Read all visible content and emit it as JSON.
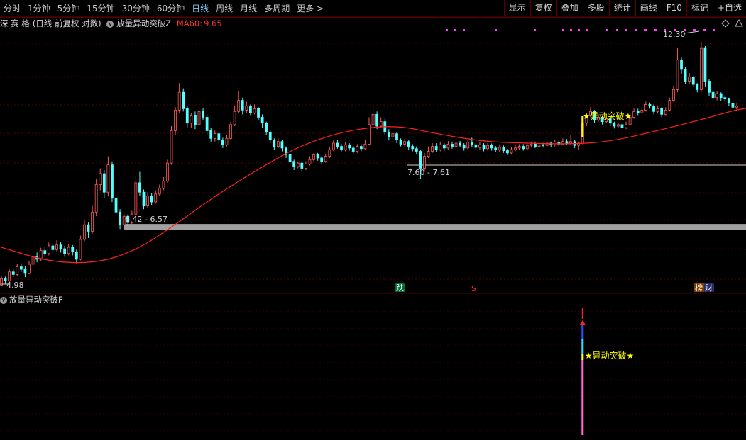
{
  "toolbar": {
    "timeframes": [
      "分时",
      "1分钟",
      "5分钟",
      "15分钟",
      "30分钟",
      "60分钟",
      "日线",
      "周线",
      "月线",
      "多周期",
      "更多 >"
    ],
    "active": "日线",
    "tools": [
      "显示",
      "复权",
      "叠加",
      "多股",
      "统计",
      "画线",
      "F10",
      "标记",
      "+自选"
    ]
  },
  "main_panel": {
    "stock_name": "深 赛 格",
    "mode": "(日线 前复权 对数)",
    "indicator_name": "放量异动突破Z",
    "ma_label": "MA60:",
    "ma_value": "9.65",
    "max_label": "12.30",
    "min_label": "4.98",
    "range1_label": "6.42 - 6.57",
    "range2_label": "7.60 - 7.61",
    "signal_text": "异动突破",
    "badge_die": "跌",
    "badge_s": "S",
    "badge_bang": "榜",
    "badge_cai": "财"
  },
  "sub_panel": {
    "indicator_name": "放量异动突破F",
    "signal_text": "异动突破"
  },
  "colors": {
    "background": "#000000",
    "grid": "#5a0000",
    "up_candle": "#ff5a5a",
    "down_candle": "#54ffff",
    "ma60": "#ff2020",
    "highlight": "#ffff00",
    "marker": "#ff3cff",
    "range_band": "#a0a0a0"
  },
  "chart_data": {
    "type": "candlestick",
    "ma": "MA60",
    "ma_last": 9.65,
    "high": 12.3,
    "low": 4.98,
    "y_domain": [
      4.85,
      12.85
    ],
    "zones": [
      {
        "label": "6.42 - 6.57",
        "low": 6.42,
        "high": 6.57
      },
      {
        "label": "7.60 - 7.61",
        "low": 7.6,
        "high": 7.61
      }
    ],
    "signal_day_index": 147,
    "candles": [
      [
        5.0,
        5.12,
        5.18,
        4.98
      ],
      [
        5.12,
        5.08,
        5.16,
        5.02
      ],
      [
        5.08,
        5.25,
        5.3,
        5.05
      ],
      [
        5.25,
        5.2,
        5.32,
        5.15
      ],
      [
        5.2,
        5.35,
        5.4,
        5.18
      ],
      [
        5.35,
        5.3,
        5.42,
        5.25
      ],
      [
        5.3,
        5.22,
        5.36,
        5.15
      ],
      [
        5.22,
        5.4,
        5.46,
        5.2
      ],
      [
        5.4,
        5.55,
        5.62,
        5.36
      ],
      [
        5.55,
        5.5,
        5.64,
        5.44
      ],
      [
        5.5,
        5.68,
        5.74,
        5.46
      ],
      [
        5.68,
        5.62,
        5.75,
        5.55
      ],
      [
        5.62,
        5.78,
        5.85,
        5.58
      ],
      [
        5.78,
        5.7,
        5.84,
        5.62
      ],
      [
        5.7,
        5.8,
        5.9,
        5.66
      ],
      [
        5.8,
        5.72,
        5.86,
        5.64
      ],
      [
        5.72,
        5.62,
        5.78,
        5.55
      ],
      [
        5.62,
        5.75,
        5.82,
        5.58
      ],
      [
        5.75,
        5.65,
        5.8,
        5.58
      ],
      [
        5.65,
        5.5,
        5.7,
        5.42
      ],
      [
        5.5,
        5.92,
        6.0,
        5.48
      ],
      [
        5.92,
        6.25,
        6.35,
        5.88
      ],
      [
        6.25,
        6.1,
        6.3,
        5.95
      ],
      [
        6.1,
        6.55,
        6.7,
        6.05
      ],
      [
        6.55,
        7.25,
        7.4,
        6.45
      ],
      [
        7.25,
        7.55,
        7.7,
        7.1
      ],
      [
        7.55,
        7.05,
        7.65,
        6.9
      ],
      [
        7.05,
        7.8,
        8.05,
        6.95
      ],
      [
        7.8,
        6.9,
        7.9,
        6.8
      ],
      [
        6.9,
        6.55,
        7.0,
        6.4
      ],
      [
        6.55,
        6.25,
        6.62,
        6.15
      ],
      [
        6.25,
        6.45,
        6.55,
        6.2
      ],
      [
        6.45,
        6.3,
        6.5,
        6.22
      ],
      [
        6.3,
        6.5,
        6.58,
        6.26
      ],
      [
        6.5,
        7.3,
        7.5,
        6.45
      ],
      [
        7.3,
        7.05,
        7.6,
        6.95
      ],
      [
        7.05,
        6.7,
        7.12,
        6.62
      ],
      [
        6.7,
        6.95,
        7.05,
        6.65
      ],
      [
        6.95,
        6.8,
        7.02,
        6.72
      ],
      [
        6.8,
        7.0,
        7.1,
        6.76
      ],
      [
        7.0,
        7.15,
        7.25,
        6.95
      ],
      [
        7.15,
        7.35,
        7.45,
        7.1
      ],
      [
        7.35,
        7.85,
        7.95,
        7.3
      ],
      [
        7.85,
        8.85,
        9.0,
        7.8
      ],
      [
        8.85,
        9.55,
        9.65,
        8.7
      ],
      [
        9.55,
        10.2,
        10.55,
        9.45
      ],
      [
        10.2,
        9.6,
        10.35,
        9.5
      ],
      [
        9.6,
        9.1,
        9.7,
        8.95
      ],
      [
        9.1,
        9.35,
        9.45,
        8.95
      ],
      [
        9.35,
        9.05,
        9.5,
        8.9
      ],
      [
        9.05,
        9.5,
        9.65,
        9.0
      ],
      [
        9.5,
        9.3,
        9.62,
        9.2
      ],
      [
        9.3,
        8.85,
        9.4,
        8.7
      ],
      [
        8.85,
        8.6,
        8.95,
        8.5
      ],
      [
        8.6,
        8.75,
        8.85,
        8.5
      ],
      [
        8.75,
        8.55,
        8.8,
        8.45
      ],
      [
        8.55,
        8.4,
        8.62,
        8.3
      ],
      [
        8.4,
        8.6,
        8.7,
        8.35
      ],
      [
        8.6,
        9.05,
        9.15,
        8.55
      ],
      [
        9.05,
        9.5,
        9.7,
        9.0
      ],
      [
        9.5,
        9.9,
        10.25,
        9.45
      ],
      [
        9.9,
        9.55,
        10.0,
        9.4
      ],
      [
        9.55,
        9.7,
        9.85,
        9.45
      ],
      [
        9.7,
        9.45,
        9.75,
        9.35
      ],
      [
        9.45,
        9.6,
        9.75,
        9.4
      ],
      [
        9.6,
        9.3,
        9.65,
        9.2
      ],
      [
        9.3,
        9.1,
        9.4,
        8.95
      ],
      [
        9.1,
        8.8,
        9.15,
        8.7
      ],
      [
        8.8,
        8.55,
        8.85,
        8.45
      ],
      [
        8.55,
        8.35,
        8.6,
        8.25
      ],
      [
        8.35,
        8.5,
        8.6,
        8.3
      ],
      [
        8.5,
        8.3,
        8.55,
        8.2
      ],
      [
        8.3,
        8.1,
        8.35,
        8.0
      ],
      [
        8.1,
        7.9,
        8.15,
        7.8
      ],
      [
        7.9,
        7.75,
        7.95,
        7.65
      ],
      [
        7.75,
        7.85,
        7.9,
        7.7
      ],
      [
        7.85,
        7.7,
        7.9,
        7.6
      ],
      [
        7.7,
        7.82,
        7.9,
        7.65
      ],
      [
        7.82,
        7.95,
        8.05,
        7.78
      ],
      [
        7.95,
        8.1,
        8.15,
        7.9
      ],
      [
        8.1,
        8.0,
        8.15,
        7.92
      ],
      [
        8.0,
        7.9,
        8.05,
        7.82
      ],
      [
        7.9,
        8.05,
        8.12,
        7.86
      ],
      [
        8.05,
        8.25,
        8.35,
        8.0
      ],
      [
        8.25,
        8.45,
        8.55,
        8.2
      ],
      [
        8.45,
        8.35,
        8.55,
        8.28
      ],
      [
        8.35,
        8.25,
        8.42,
        8.2
      ],
      [
        8.25,
        8.4,
        8.5,
        8.2
      ],
      [
        8.4,
        8.3,
        8.45,
        8.22
      ],
      [
        8.3,
        8.2,
        8.36,
        8.12
      ],
      [
        8.2,
        8.35,
        8.42,
        8.15
      ],
      [
        8.35,
        8.28,
        8.42,
        8.2
      ],
      [
        8.28,
        8.42,
        8.55,
        8.25
      ],
      [
        8.42,
        9.05,
        9.3,
        8.38
      ],
      [
        9.05,
        9.4,
        9.7,
        8.95
      ],
      [
        9.4,
        9.0,
        9.5,
        8.9
      ],
      [
        9.0,
        9.15,
        9.3,
        8.95
      ],
      [
        9.15,
        8.8,
        9.25,
        8.7
      ],
      [
        8.8,
        8.65,
        8.9,
        8.55
      ],
      [
        8.65,
        8.75,
        8.82,
        8.5
      ],
      [
        8.75,
        8.55,
        8.8,
        8.45
      ],
      [
        8.55,
        8.42,
        8.6,
        8.35
      ],
      [
        8.42,
        8.5,
        8.58,
        8.35
      ],
      [
        8.5,
        8.35,
        8.55,
        8.25
      ],
      [
        8.35,
        8.28,
        8.42,
        8.2
      ],
      [
        8.28,
        8.2,
        8.35,
        8.1
      ],
      [
        8.2,
        7.7,
        8.25,
        7.4
      ],
      [
        7.7,
        8.05,
        8.15,
        7.6
      ],
      [
        8.05,
        8.2,
        8.35,
        8.0
      ],
      [
        8.2,
        8.35,
        8.45,
        8.15
      ],
      [
        8.35,
        8.25,
        8.45,
        8.18
      ],
      [
        8.25,
        8.4,
        8.5,
        8.2
      ],
      [
        8.4,
        8.3,
        8.45,
        8.22
      ],
      [
        8.3,
        8.42,
        8.52,
        8.25
      ],
      [
        8.42,
        8.35,
        8.5,
        8.28
      ],
      [
        8.35,
        8.45,
        8.55,
        8.3
      ],
      [
        8.45,
        8.38,
        8.52,
        8.32
      ],
      [
        8.38,
        8.3,
        8.45,
        8.22
      ],
      [
        8.3,
        8.48,
        8.55,
        8.26
      ],
      [
        8.48,
        8.4,
        8.62,
        8.32
      ],
      [
        8.4,
        8.32,
        8.46,
        8.25
      ],
      [
        8.32,
        8.4,
        8.48,
        8.25
      ],
      [
        8.4,
        8.28,
        8.45,
        8.2
      ],
      [
        8.28,
        8.38,
        8.45,
        8.22
      ],
      [
        8.38,
        8.3,
        8.44,
        8.22
      ],
      [
        8.3,
        8.25,
        8.36,
        8.18
      ],
      [
        8.25,
        8.32,
        8.4,
        8.18
      ],
      [
        8.32,
        8.22,
        8.38,
        8.15
      ],
      [
        8.22,
        8.15,
        8.28,
        8.08
      ],
      [
        8.15,
        8.25,
        8.32,
        8.1
      ],
      [
        8.25,
        8.3,
        8.38,
        8.2
      ],
      [
        8.3,
        8.35,
        8.42,
        8.25
      ],
      [
        8.35,
        8.28,
        8.42,
        8.22
      ],
      [
        8.28,
        8.38,
        8.45,
        8.24
      ],
      [
        8.38,
        8.42,
        8.5,
        8.32
      ],
      [
        8.42,
        8.35,
        8.5,
        8.3
      ],
      [
        8.35,
        8.4,
        8.48,
        8.3
      ],
      [
        8.4,
        8.38,
        8.46,
        8.32
      ],
      [
        8.38,
        8.45,
        8.52,
        8.33
      ],
      [
        8.45,
        8.4,
        8.5,
        8.34
      ],
      [
        8.4,
        8.48,
        8.55,
        8.35
      ],
      [
        8.48,
        8.42,
        8.55,
        8.36
      ],
      [
        8.42,
        8.5,
        8.6,
        8.38
      ],
      [
        8.5,
        8.45,
        8.58,
        8.4
      ],
      [
        8.45,
        8.5,
        8.72,
        8.4
      ],
      [
        8.5,
        8.38,
        8.55,
        8.3
      ],
      [
        8.38,
        8.45,
        8.5,
        8.25
      ],
      [
        8.45,
        9.1,
        9.2,
        8.42
      ],
      [
        9.1,
        9.35,
        9.45,
        9.0
      ],
      [
        9.35,
        9.5,
        9.65,
        9.3
      ],
      [
        9.5,
        9.2,
        9.55,
        9.1
      ],
      [
        9.2,
        9.3,
        9.4,
        9.15
      ],
      [
        9.3,
        9.15,
        9.35,
        9.05
      ],
      [
        9.15,
        9.25,
        9.32,
        9.1
      ],
      [
        9.25,
        9.1,
        9.3,
        9.0
      ],
      [
        9.1,
        9.0,
        9.15,
        8.92
      ],
      [
        9.0,
        9.05,
        9.12,
        8.95
      ],
      [
        9.05,
        8.95,
        9.1,
        8.85
      ],
      [
        8.95,
        9.05,
        9.15,
        8.9
      ],
      [
        9.05,
        9.3,
        9.4,
        9.0
      ],
      [
        9.3,
        9.5,
        9.6,
        9.25
      ],
      [
        9.5,
        9.45,
        9.6,
        9.35
      ],
      [
        9.45,
        9.55,
        9.65,
        9.4
      ],
      [
        9.55,
        9.75,
        9.85,
        9.5
      ],
      [
        9.75,
        9.7,
        9.82,
        9.6
      ],
      [
        9.7,
        9.5,
        9.75,
        9.4
      ],
      [
        9.5,
        9.6,
        9.7,
        9.45
      ],
      [
        9.6,
        9.4,
        9.65,
        9.3
      ],
      [
        9.4,
        9.55,
        9.65,
        9.35
      ],
      [
        9.55,
        9.9,
        10.0,
        9.5
      ],
      [
        9.9,
        10.3,
        10.45,
        9.85
      ],
      [
        10.3,
        11.5,
        12.0,
        10.2
      ],
      [
        11.5,
        11.1,
        11.6,
        10.9
      ],
      [
        11.1,
        10.6,
        11.2,
        10.5
      ],
      [
        10.6,
        10.8,
        10.95,
        10.5
      ],
      [
        10.8,
        10.5,
        10.85,
        10.4
      ],
      [
        10.5,
        10.3,
        10.55,
        10.2
      ],
      [
        10.3,
        12.0,
        12.3,
        10.2
      ],
      [
        12.0,
        10.6,
        12.1,
        10.4
      ],
      [
        10.6,
        10.2,
        10.7,
        10.05
      ],
      [
        10.2,
        10.0,
        10.3,
        9.9
      ],
      [
        10.0,
        10.15,
        10.25,
        9.9
      ],
      [
        10.15,
        10.0,
        10.2,
        9.88
      ],
      [
        10.0,
        9.95,
        10.08,
        9.85
      ],
      [
        9.95,
        9.8,
        10.0,
        9.7
      ],
      [
        9.8,
        9.65,
        9.85,
        9.55
      ],
      [
        9.65,
        9.7,
        9.8,
        9.55
      ]
    ],
    "ma60": [
      [
        0,
        5.75
      ],
      [
        12,
        5.45
      ],
      [
        24,
        5.42
      ],
      [
        34,
        5.68
      ],
      [
        44,
        6.25
      ],
      [
        54,
        6.95
      ],
      [
        66,
        7.75
      ],
      [
        76,
        8.4
      ],
      [
        88,
        8.88
      ],
      [
        100,
        9.03
      ],
      [
        110,
        8.75
      ],
      [
        122,
        8.5
      ],
      [
        132,
        8.45
      ],
      [
        144,
        8.42
      ],
      [
        154,
        8.5
      ],
      [
        166,
        8.85
      ],
      [
        178,
        9.25
      ],
      [
        188,
        9.65
      ],
      [
        196,
        9.65
      ]
    ]
  }
}
